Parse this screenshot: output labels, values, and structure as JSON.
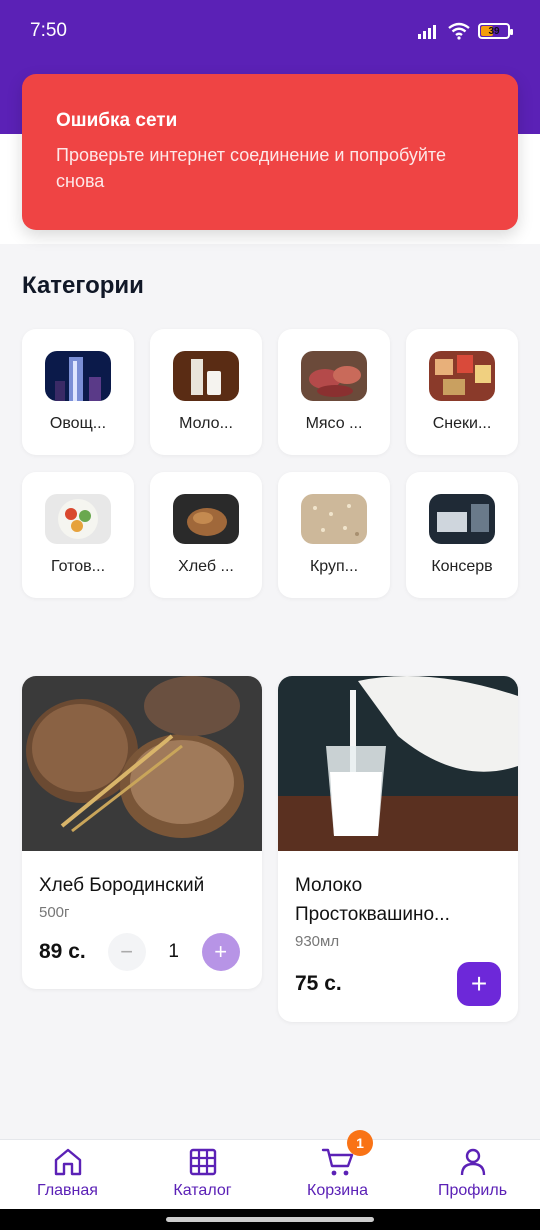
{
  "status_bar": {
    "time": "7:50",
    "battery": "39"
  },
  "error_toast": {
    "title": "Ошибка сети",
    "message": "Проверьте интернет соединение и попробуйте снова"
  },
  "categories_title": "Категории",
  "categories": [
    {
      "label": "Овощ..."
    },
    {
      "label": "Моло..."
    },
    {
      "label": "Мясо ..."
    },
    {
      "label": "Снеки..."
    },
    {
      "label": "Готов..."
    },
    {
      "label": "Хлеб ..."
    },
    {
      "label": "Круп..."
    },
    {
      "label": "Консерв"
    }
  ],
  "products": [
    {
      "name": "Хлеб Бородинский",
      "weight": "500г",
      "price": "89 с.",
      "quantity": "1"
    },
    {
      "name": "Молоко Простоквашино...",
      "weight": "930мл",
      "price": "75 с."
    }
  ],
  "bottom_nav": [
    {
      "label": "Главная",
      "icon": "home-icon"
    },
    {
      "label": "Каталог",
      "icon": "grid-icon"
    },
    {
      "label": "Корзина",
      "icon": "cart-icon",
      "badge": "1"
    },
    {
      "label": "Профиль",
      "icon": "user-icon"
    }
  ],
  "colors": {
    "brand": "#5b21b6",
    "error": "#ef4444",
    "badge": "#f97316"
  }
}
